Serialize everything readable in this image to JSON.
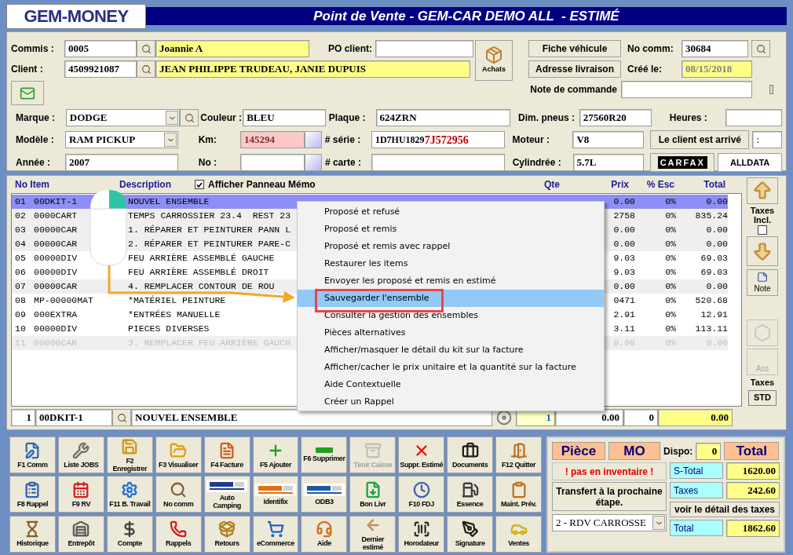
{
  "logo": {
    "text": "GEM-MONEY"
  },
  "window": {
    "title": "Point de Vente - GEM-CAR DEMO ALL  - ESTIMÉ"
  },
  "header": {
    "commis": {
      "label": "Commis :",
      "code": "0005",
      "name": "Joannie A"
    },
    "client": {
      "label": "Client :",
      "code": "4509921087",
      "name": "JEAN PHILIPPE TRUDEAU, JANIE DUPUIS"
    },
    "po_client": {
      "label": "PO client:"
    },
    "achats_button": "Achats",
    "fiche_button": "Fiche véhicule",
    "adresse_button": "Adresse livraison",
    "no_comm": {
      "label": "No comm:",
      "value": "30684"
    },
    "cree_le": {
      "label": "Créé le:",
      "value": "08/15/2018"
    },
    "note": {
      "label": "Note de commande"
    }
  },
  "vehicle": {
    "marque": {
      "label": "Marque :",
      "value": "DODGE"
    },
    "modele": {
      "label": "Modèle :",
      "value": "RAM PICKUP"
    },
    "annee": {
      "label": "Année :",
      "value": "2007"
    },
    "couleur": {
      "label": "Couleur :",
      "value": "BLEU"
    },
    "km": {
      "label": "Km:",
      "value": "145294",
      "warning": true
    },
    "no": {
      "label": "No :"
    },
    "plaque": {
      "label": "Plaque :",
      "value": "624ZRN"
    },
    "serie": {
      "label": "# série :",
      "value": "1D7HU1829",
      "value_highlight": "7J572956"
    },
    "carte": {
      "label": "# carte :"
    },
    "dim_pneus": {
      "label": "Dim. pneus :",
      "value": "27560R20"
    },
    "moteur": {
      "label": "Moteur :",
      "value": "V8"
    },
    "cylindree": {
      "label": "Cylindrée :",
      "value": "5.7L"
    },
    "heures": {
      "label": "Heures :"
    },
    "client_arrive_button": "Le client est arrivé",
    "client_arrive_field": ":",
    "carfax": "CARFAX",
    "alldata": "ALLDATA"
  },
  "table": {
    "columns": [
      "No Item",
      "Description",
      "Qte",
      "Prix",
      "% Esc",
      "Total"
    ],
    "memo": {
      "label": "Afficher Panneau Mémo",
      "checked": true
    },
    "rows": [
      {
        "no": "01",
        "code": "00DKIT-1",
        "description": "NOUVEL ENSEMBLE",
        "prix": "0.00",
        "esc": "0%",
        "total": "0.00",
        "selected": true,
        "shaded": false,
        "disabled": false
      },
      {
        "no": "02",
        "code": "0000CART",
        "description": "TEMPS CARROSSIER 23.4  REST 23",
        "prix": "2758",
        "esc": "0%",
        "total": "835.24",
        "selected": false,
        "shaded": true,
        "disabled": false
      },
      {
        "no": "03",
        "code": "00000CAR",
        "description": "1. RÉPARER ET PEINTURER PANN L",
        "prix": "0.00",
        "esc": "0%",
        "total": "0.00",
        "selected": false,
        "shaded": true,
        "disabled": false
      },
      {
        "no": "04",
        "code": "00000CAR",
        "description": "2. RÉPARER ET PEINTURER PARE-C",
        "prix": "0.00",
        "esc": "0%",
        "total": "0.00",
        "selected": false,
        "shaded": true,
        "disabled": false
      },
      {
        "no": "05",
        "code": "00000DIV",
        "description": "FEU ARRIÈRE ASSEMBLÉ GAUCHE",
        "prix": "9.03",
        "esc": "0%",
        "total": "69.03",
        "selected": false,
        "shaded": false,
        "disabled": false
      },
      {
        "no": "06",
        "code": "00000DIV",
        "description": "FEU ARRIÈRE ASSEMBLÉ DROIT",
        "prix": "9.03",
        "esc": "0%",
        "total": "69.03",
        "selected": false,
        "shaded": false,
        "disabled": false
      },
      {
        "no": "07",
        "code": "00000CAR",
        "description": "4. REMPLACER CONTOUR DE ROU",
        "prix": "0.00",
        "esc": "0%",
        "total": "0.00",
        "selected": false,
        "shaded": true,
        "disabled": false
      },
      {
        "no": "08",
        "code": "MP-00000MAT",
        "description": "*MATÉRIEL PEINTURE",
        "prix": "0471",
        "esc": "0%",
        "total": "520.68",
        "selected": false,
        "shaded": false,
        "disabled": false
      },
      {
        "no": "09",
        "code": "000EXTRA",
        "description": "*ENTRÉES MANUELLE",
        "prix": "2.91",
        "esc": "0%",
        "total": "12.91",
        "selected": false,
        "shaded": false,
        "disabled": false
      },
      {
        "no": "10",
        "code": "00000DIV",
        "description": "PIECES DIVERSES",
        "prix": "3.11",
        "esc": "0%",
        "total": "113.11",
        "selected": false,
        "shaded": false,
        "disabled": false
      },
      {
        "no": "11",
        "code": "00000CAR",
        "description": "3. REMPLACER FEU ARRIÈRE GAUCH",
        "prix": "0.00",
        "esc": "0%",
        "total": "0.00",
        "selected": false,
        "shaded": true,
        "disabled": true
      }
    ],
    "edit_row": {
      "line": "1",
      "code": "00DKIT-1",
      "description": "NOUVEL ENSEMBLE",
      "qty": "1",
      "price": "0.00",
      "discount": "0",
      "total": "0.00"
    }
  },
  "side": {
    "taxes_incl": {
      "label": "Taxes Incl.",
      "checked": false
    },
    "note_button": "Note",
    "ass_button": {
      "label": "Ass",
      "disabled": true
    },
    "taxes_label": "Taxes",
    "std_button": "STD"
  },
  "context_menu": {
    "items": [
      {
        "label": "Proposé et refusé",
        "selected": false
      },
      {
        "label": "Proposé et remis",
        "selected": false
      },
      {
        "label": "Proposé et remis avec rappel",
        "selected": false
      },
      {
        "label": "Restaurer les items",
        "selected": false
      },
      {
        "label": "Envoyer les proposé et remis en estimé",
        "selected": false
      },
      {
        "label": "Sauvegarder l'ensemble",
        "selected": true
      },
      {
        "label": "Consulter la gestion des ensembles",
        "selected": false
      },
      {
        "label": "Pièces alternatives",
        "selected": false
      },
      {
        "label": "Afficher/masquer le détail du kit sur la facture",
        "selected": false
      },
      {
        "label": "Afficher/cacher le prix unitaire et la quantité sur la facture",
        "selected": false
      },
      {
        "label": "Aide Contextuelle",
        "selected": false
      },
      {
        "label": "Créer un Rappel",
        "selected": false
      }
    ]
  },
  "toolbar": [
    {
      "label": "F1 Comm",
      "disabled": false
    },
    {
      "label": "Liste JOBS",
      "disabled": false
    },
    {
      "label": "F2 Enregistrer",
      "disabled": false
    },
    {
      "label": "F3 Visualiser",
      "disabled": false
    },
    {
      "label": "F4  Facture",
      "disabled": false
    },
    {
      "label": "F5  Ajouter",
      "disabled": false
    },
    {
      "label": "F6 Supprimer",
      "disabled": false
    },
    {
      "label": "Tiroir Caisse",
      "disabled": true
    },
    {
      "label": "Suppr. Estimé",
      "disabled": false
    },
    {
      "label": "Documents",
      "disabled": false
    },
    {
      "label": "F12 Quitter",
      "disabled": false
    },
    {
      "label": "F8 Rappel",
      "disabled": false
    },
    {
      "label": "F9 RV",
      "disabled": false
    },
    {
      "label": "F11 B. Travail",
      "disabled": false
    },
    {
      "label": "No comm",
      "disabled": false
    },
    {
      "label": "Auto Camping",
      "disabled": false
    },
    {
      "label": "Identifix",
      "disabled": false
    },
    {
      "label": "ODB3",
      "disabled": false
    },
    {
      "label": "Bon Livr",
      "disabled": false
    },
    {
      "label": "F10  FDJ",
      "disabled": false
    },
    {
      "label": "Essence",
      "disabled": false
    },
    {
      "label": "Maint. Prév.",
      "disabled": false
    },
    {
      "label": "Historique",
      "disabled": false
    },
    {
      "label": "Entrepôt",
      "disabled": false
    },
    {
      "label": "Compte",
      "disabled": false
    },
    {
      "label": "Rappels",
      "disabled": false
    },
    {
      "label": "Retours",
      "disabled": false
    },
    {
      "label": "eCommerce",
      "disabled": false
    },
    {
      "label": "Aide",
      "disabled": false
    },
    {
      "label": "Dernier estimé",
      "disabled": false
    },
    {
      "label": "Horodateur",
      "disabled": false
    },
    {
      "label": "Signature",
      "disabled": false
    },
    {
      "label": "Ventes",
      "disabled": false
    }
  ],
  "summary": {
    "piece": "Pièce",
    "mo": "MO",
    "dispo": {
      "label": "Dispo:",
      "value": "0"
    },
    "total_header": "Total",
    "warning": "! pas en inventaire !",
    "transfer_button": "Transfert à la prochaine étape.",
    "step_select": "2 - RDV CARROSSE",
    "stotal": {
      "label": "S-Total",
      "value": "1620.00"
    },
    "taxes": {
      "label": "Taxes",
      "value": "242.60"
    },
    "detail_button": "voir le détail des taxes",
    "total": {
      "label": "Total",
      "value": "1862.60"
    }
  }
}
